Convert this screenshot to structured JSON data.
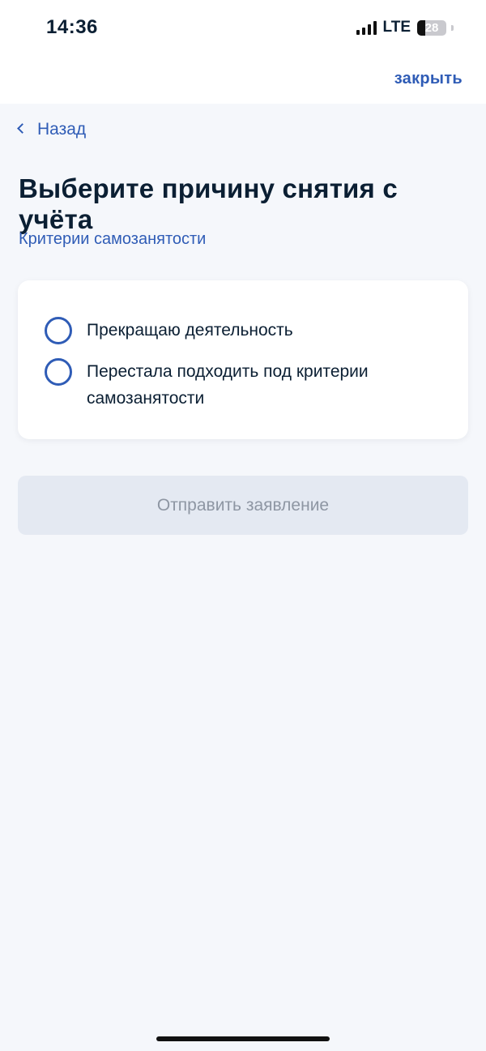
{
  "status_bar": {
    "time": "14:36",
    "network": "LTE",
    "battery": "28",
    "battery_level": 0.28
  },
  "header": {
    "close_label": "закрыть"
  },
  "nav": {
    "back_label": "Назад"
  },
  "main": {
    "title": "Выберите причину снятия с учёта",
    "criteria_link": "Критерии самозанятости",
    "options": [
      {
        "label": "Прекращаю деятельность",
        "selected": false
      },
      {
        "label": "Перестала подходить под критерии самозанятости",
        "selected": false
      }
    ],
    "submit_label": "Отправить заявление",
    "submit_enabled": false
  },
  "colors": {
    "accent": "#2f5cb6",
    "text": "#0b1f33",
    "background": "#f5f7fb",
    "disabled_button": "#e4e9f2",
    "disabled_text": "#8e96a3"
  }
}
